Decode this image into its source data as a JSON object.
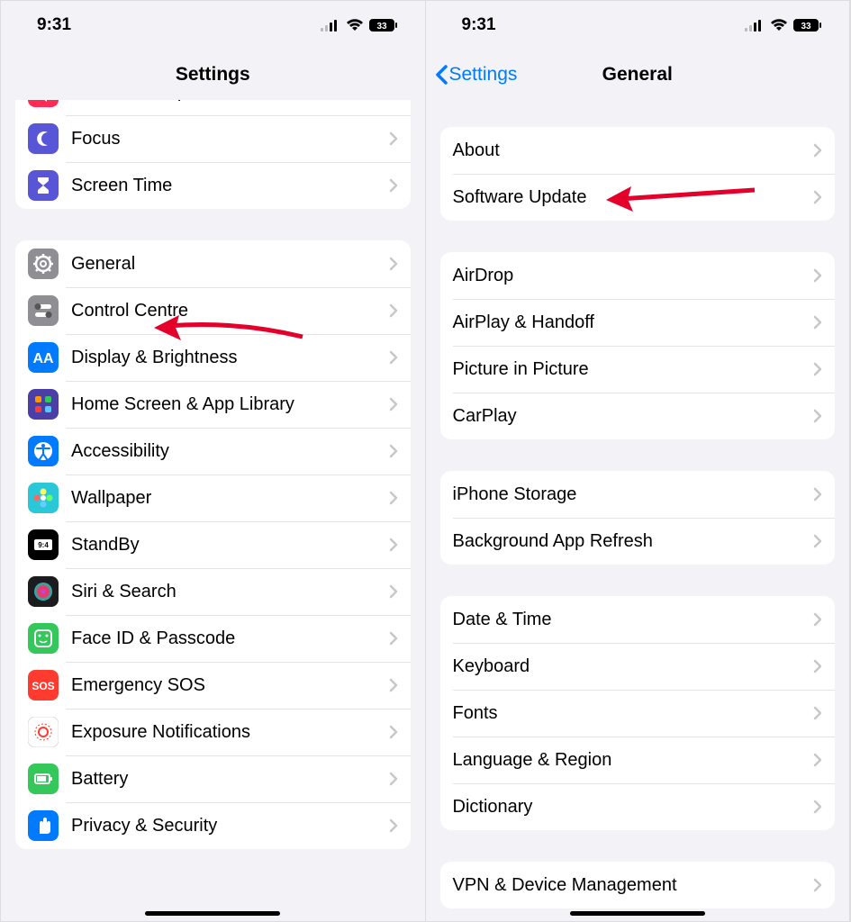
{
  "status": {
    "time": "9:31",
    "battery": "33"
  },
  "left": {
    "title": "Settings",
    "group0": [
      {
        "label": "Sounds & Haptics",
        "color": "#ff2d55",
        "icon": "sounds"
      },
      {
        "label": "Focus",
        "color": "#5856d6",
        "icon": "moon"
      },
      {
        "label": "Screen Time",
        "color": "#5856d6",
        "icon": "hourglass"
      }
    ],
    "group1": [
      {
        "label": "General",
        "color": "#8e8e93",
        "icon": "gear"
      },
      {
        "label": "Control Centre",
        "color": "#8e8e93",
        "icon": "switches"
      },
      {
        "label": "Display & Brightness",
        "color": "#007aff",
        "icon": "brightness"
      },
      {
        "label": "Home Screen & App Library",
        "color": "#4b3fa7",
        "icon": "grid"
      },
      {
        "label": "Accessibility",
        "color": "#007aff",
        "icon": "accessibility"
      },
      {
        "label": "Wallpaper",
        "color": "#29c7d8",
        "icon": "flower"
      },
      {
        "label": "StandBy",
        "color": "#000000",
        "icon": "standby"
      },
      {
        "label": "Siri & Search",
        "color": "#1c1c1e",
        "icon": "siri"
      },
      {
        "label": "Face ID & Passcode",
        "color": "#34c759",
        "icon": "faceid"
      },
      {
        "label": "Emergency SOS",
        "color": "#ff3b30",
        "icon": "sos"
      },
      {
        "label": "Exposure Notifications",
        "color": "#ffffff",
        "icon": "exposure"
      },
      {
        "label": "Battery",
        "color": "#34c759",
        "icon": "battery"
      },
      {
        "label": "Privacy & Security",
        "color": "#007aff",
        "icon": "hand"
      }
    ]
  },
  "right": {
    "back": "Settings",
    "title": "General",
    "g0": [
      {
        "label": "About"
      },
      {
        "label": "Software Update"
      }
    ],
    "g1": [
      {
        "label": "AirDrop"
      },
      {
        "label": "AirPlay & Handoff"
      },
      {
        "label": "Picture in Picture"
      },
      {
        "label": "CarPlay"
      }
    ],
    "g2": [
      {
        "label": "iPhone Storage"
      },
      {
        "label": "Background App Refresh"
      }
    ],
    "g3": [
      {
        "label": "Date & Time"
      },
      {
        "label": "Keyboard"
      },
      {
        "label": "Fonts"
      },
      {
        "label": "Language & Region"
      },
      {
        "label": "Dictionary"
      }
    ],
    "g4": [
      {
        "label": "VPN & Device Management"
      }
    ]
  }
}
